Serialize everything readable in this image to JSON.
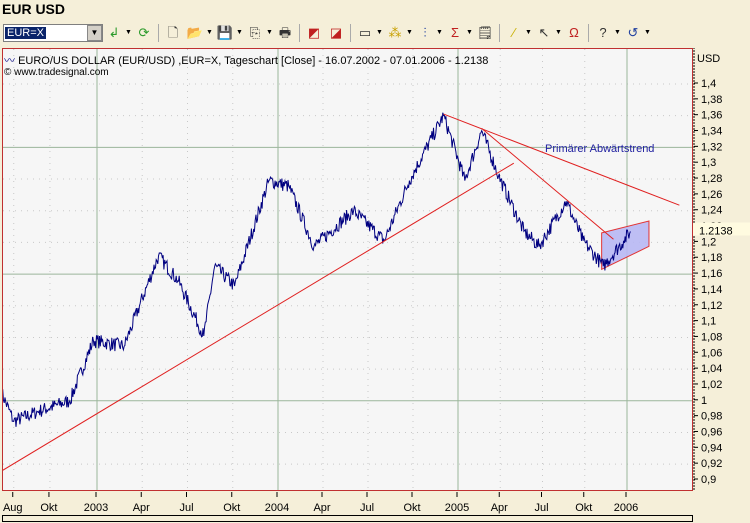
{
  "window": {
    "title": "EUR USD"
  },
  "toolbar": {
    "symbol": "EUR=X",
    "icons": [
      "go-arrow-icon",
      "refresh-icon",
      "new-document-icon",
      "open-folder-icon",
      "save-icon",
      "copy-icon",
      "print-icon",
      "chart-back-icon",
      "chart-forward-icon",
      "window-icon",
      "indicator-icon",
      "strategy-icon",
      "sigma-icon",
      "properties-icon",
      "draw-line-icon",
      "cursor-icon",
      "magnet-icon",
      "help-icon",
      "undo-icon"
    ]
  },
  "chart": {
    "header": "EURO/US DOLLAR (EUR/USD) ,EUR=X, Tageschart [Close] - 16.07.2002 - 07.01.2006 - 1.2138",
    "copyright": "© www.tradesignal.com",
    "annotation": "Primärer Abwärtstrend",
    "axis_unit": "USD",
    "last_price": "1.2138"
  },
  "chart_data": {
    "type": "line",
    "title": "EURO/US DOLLAR (EUR/USD) ,EUR=X, Tageschart [Close] - 16.07.2002 - 07.01.2006 - 1.2138",
    "ylabel": "USD",
    "ylim": [
      0.89,
      1.41
    ],
    "yticks": [
      "1,4",
      "1,38",
      "1,36",
      "1,34",
      "1,32",
      "1,3",
      "1,28",
      "1,26",
      "1,24",
      "1,22",
      "1,2",
      "1,18",
      "1,16",
      "1,14",
      "1,12",
      "1,1",
      "1,08",
      "1,06",
      "1,04",
      "1,02",
      "1",
      "0,98",
      "0,96",
      "0,94",
      "0,92",
      "0,9"
    ],
    "xticks": [
      {
        "label": "Aug",
        "t": 2002.54
      },
      {
        "label": "Okt",
        "t": 2002.74
      },
      {
        "label": "2003",
        "t": 2003.0
      },
      {
        "label": "Apr",
        "t": 2003.25
      },
      {
        "label": "Jul",
        "t": 2003.5
      },
      {
        "label": "Okt",
        "t": 2003.75
      },
      {
        "label": "2004",
        "t": 2004.0
      },
      {
        "label": "Apr",
        "t": 2004.25
      },
      {
        "label": "Jul",
        "t": 2004.5
      },
      {
        "label": "Okt",
        "t": 2004.75
      },
      {
        "label": "2005",
        "t": 2005.0
      },
      {
        "label": "Apr",
        "t": 2005.25
      },
      {
        "label": "Jul",
        "t": 2005.5
      },
      {
        "label": "Okt",
        "t": 2005.75
      },
      {
        "label": "2006",
        "t": 2006.0
      }
    ],
    "series": [
      {
        "name": "EUR/USD Close",
        "color": "#000080",
        "points": [
          [
            2002.47,
            1.012
          ],
          [
            2002.54,
            0.974
          ],
          [
            2002.68,
            0.987
          ],
          [
            2002.85,
            1.0
          ],
          [
            2002.98,
            1.076
          ],
          [
            2003.15,
            1.069
          ],
          [
            2003.34,
            1.183
          ],
          [
            2003.45,
            1.151
          ],
          [
            2003.59,
            1.082
          ],
          [
            2003.65,
            1.17
          ],
          [
            2003.76,
            1.145
          ],
          [
            2003.95,
            1.278
          ],
          [
            2004.06,
            1.271
          ],
          [
            2004.2,
            1.195
          ],
          [
            2004.42,
            1.24
          ],
          [
            2004.59,
            1.202
          ],
          [
            2004.73,
            1.278
          ],
          [
            2004.92,
            1.36
          ],
          [
            2005.04,
            1.278
          ],
          [
            2005.14,
            1.341
          ],
          [
            2005.24,
            1.284
          ],
          [
            2005.39,
            1.214
          ],
          [
            2005.48,
            1.195
          ],
          [
            2005.64,
            1.252
          ],
          [
            2005.74,
            1.202
          ],
          [
            2005.86,
            1.17
          ],
          [
            2005.98,
            1.202
          ],
          [
            2006.02,
            1.2138
          ]
        ]
      }
    ],
    "trendlines": [
      {
        "name": "support",
        "color": "#e02020",
        "from": [
          2002.47,
          0.911
        ],
        "to": [
          2005.33,
          1.3
        ]
      },
      {
        "name": "primary-downtrend",
        "color": "#e02020",
        "from": [
          2004.92,
          1.362
        ],
        "to": [
          2006.31,
          1.247
        ]
      },
      {
        "name": "secondary-downtrend",
        "color": "#e02020",
        "from": [
          2005.14,
          1.344
        ],
        "to": [
          2005.92,
          1.204
        ]
      }
    ],
    "channel": {
      "color": "#9999ee",
      "lower": [
        [
          2005.85,
          1.166
        ],
        [
          2006.13,
          1.195
        ]
      ],
      "upper": [
        [
          2005.85,
          1.212
        ],
        [
          2006.13,
          1.227
        ]
      ]
    }
  }
}
